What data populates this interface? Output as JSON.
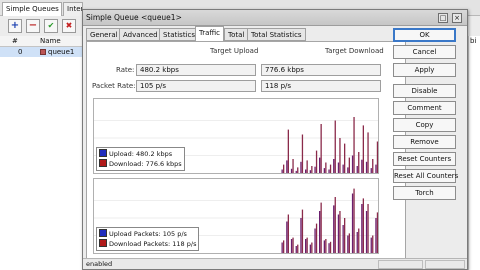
{
  "background": {
    "tabs": [
      "Simple Queues",
      "Interfa"
    ],
    "toolbar_icons": [
      "add-icon",
      "remove-icon",
      "enable-icon",
      "disable-icon"
    ],
    "columns": [
      "#",
      "Name"
    ],
    "right_column_fragment": "bi",
    "row": {
      "index": "0",
      "name": "queue1"
    }
  },
  "dialog": {
    "title": "Simple Queue <queue1>",
    "tabs": [
      "General",
      "Advanced",
      "Statistics",
      "Traffic",
      "Total",
      "Total Statistics"
    ],
    "active_tab": "Traffic",
    "traffic": {
      "col_upload_header": "Target Upload",
      "col_download_header": "Target Download",
      "rate_label": "Rate:",
      "rate_upload": "480.2 kbps",
      "rate_download": "776.6 kbps",
      "packet_rate_label": "Packet Rate:",
      "packet_upload": "105 p/s",
      "packet_download": "118 p/s"
    },
    "graph1_legend": {
      "upload": "Upload:  480.2 kbps",
      "download": "Download:  776.6 kbps"
    },
    "graph2_legend": {
      "upload": "Upload Packets:  105 p/s",
      "download": "Download Packets:  118 p/s"
    },
    "buttons": [
      "OK",
      "Cancel",
      "Apply",
      "Disable",
      "Comment",
      "Copy",
      "Remove",
      "Reset Counters",
      "Reset All Counters",
      "Torch"
    ],
    "status": "enabled",
    "colors": {
      "upload": "#1f2dbf",
      "download": "#b11a1a",
      "bars": "#6b1f6e"
    }
  },
  "chart_data": [
    {
      "type": "bar",
      "series": [
        {
          "name": "Upload",
          "values": [
            0,
            0,
            0,
            0,
            0,
            0,
            0,
            0,
            0,
            0,
            0,
            0,
            0,
            0,
            0,
            0,
            0,
            0,
            0,
            0,
            0,
            0,
            0,
            0,
            0,
            0,
            0,
            0,
            0,
            0,
            0,
            0,
            0,
            0,
            0,
            0,
            0,
            0,
            0,
            0,
            0.05,
            0.18,
            0.06,
            0.03,
            0.16,
            0.05,
            0.04,
            0.09,
            0.22,
            0.07,
            0.05,
            0.2,
            0.15,
            0.12,
            0.08,
            0.25,
            0.1,
            0.19,
            0.16,
            0.07,
            0.12
          ]
        },
        {
          "name": "Download",
          "values": [
            0,
            0,
            0,
            0,
            0,
            0,
            0,
            0,
            0,
            0,
            0,
            0,
            0,
            0,
            0,
            0,
            0,
            0,
            0,
            0,
            0,
            0,
            0,
            0,
            0,
            0,
            0,
            0,
            0,
            0,
            0,
            0,
            0,
            0,
            0,
            0,
            0,
            0,
            0,
            0,
            0.12,
            0.62,
            0.2,
            0.08,
            0.55,
            0.18,
            0.1,
            0.32,
            0.7,
            0.15,
            0.12,
            0.75,
            0.5,
            0.42,
            0.22,
            0.8,
            0.3,
            0.68,
            0.58,
            0.2,
            0.45
          ]
        }
      ]
    },
    {
      "type": "bar",
      "series": [
        {
          "name": "Upload Packets",
          "values": [
            0,
            0,
            0,
            0,
            0,
            0,
            0,
            0,
            0,
            0,
            0,
            0,
            0,
            0,
            0,
            0,
            0,
            0,
            0,
            0,
            0,
            0,
            0,
            0,
            0,
            0,
            0,
            0,
            0,
            0,
            0,
            0,
            0,
            0,
            0,
            0,
            0,
            0,
            0,
            0,
            0.15,
            0.45,
            0.2,
            0.1,
            0.5,
            0.2,
            0.12,
            0.35,
            0.6,
            0.18,
            0.14,
            0.68,
            0.55,
            0.4,
            0.25,
            0.85,
            0.3,
            0.7,
            0.6,
            0.22,
            0.5
          ]
        },
        {
          "name": "Download Packets",
          "values": [
            0,
            0,
            0,
            0,
            0,
            0,
            0,
            0,
            0,
            0,
            0,
            0,
            0,
            0,
            0,
            0,
            0,
            0,
            0,
            0,
            0,
            0,
            0,
            0,
            0,
            0,
            0,
            0,
            0,
            0,
            0,
            0,
            0,
            0,
            0,
            0,
            0,
            0,
            0,
            0,
            0.18,
            0.55,
            0.22,
            0.12,
            0.62,
            0.22,
            0.15,
            0.42,
            0.72,
            0.2,
            0.16,
            0.8,
            0.6,
            0.5,
            0.28,
            0.92,
            0.35,
            0.78,
            0.7,
            0.25,
            0.58
          ]
        }
      ]
    }
  ]
}
